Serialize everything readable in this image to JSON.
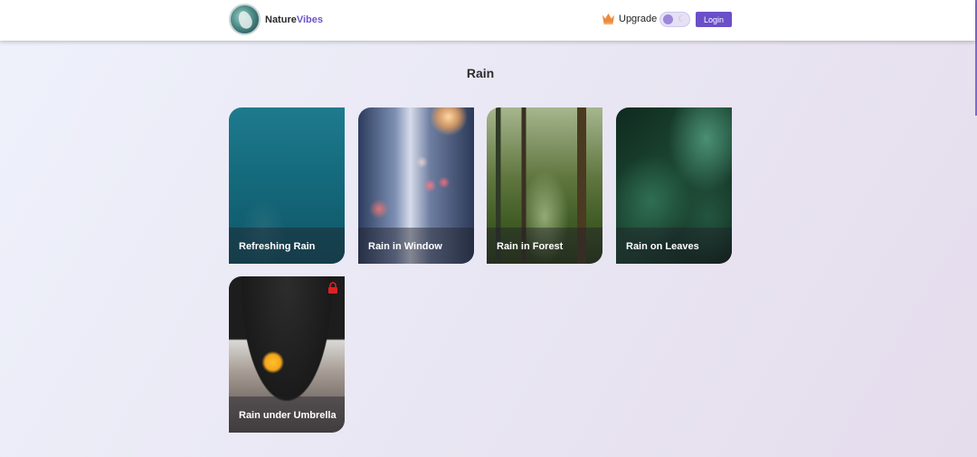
{
  "header": {
    "brand_part1": "Nature",
    "brand_part2": "Vibes",
    "upgrade_label": "Upgrade",
    "login_label": "Login",
    "accent_color": "#6a4fc9",
    "icons": {
      "logo": "nature-logo",
      "upgrade": "crown-icon",
      "theme_toggle": "moon-icon"
    }
  },
  "page": {
    "title": "Rain"
  },
  "cards": [
    {
      "label": "Refreshing Rain",
      "locked": false
    },
    {
      "label": "Rain in Window",
      "locked": false
    },
    {
      "label": "Rain in Forest",
      "locked": false
    },
    {
      "label": "Rain on Leaves",
      "locked": false
    },
    {
      "label": "Rain under Umbrella",
      "locked": true
    }
  ],
  "colors": {
    "lock": "#e02020",
    "crown": "#f08a3a"
  }
}
